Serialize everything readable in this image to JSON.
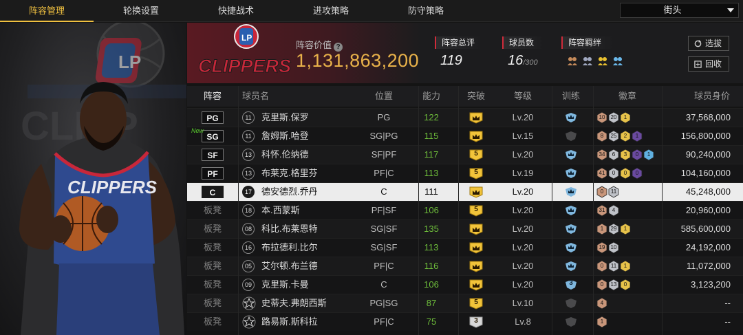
{
  "nav": {
    "tabs": [
      {
        "label": "阵容管理",
        "active": true
      },
      {
        "label": "轮换设置"
      },
      {
        "label": "快捷战术"
      },
      {
        "label": "进攻策略"
      },
      {
        "label": "防守策略"
      }
    ],
    "mode_select": {
      "value": "街头"
    }
  },
  "team": {
    "logo_text": "CLIPPERS",
    "art_jersey_text": "CLIPPERS",
    "value_label": "阵容价值",
    "value": "1,131,863,200",
    "overall_label": "阵容总评",
    "overall": "119",
    "players_label": "球员数",
    "players": "16",
    "players_max": "/300",
    "chemistry_label": "阵容羁绊"
  },
  "buttons": {
    "select": "选拔",
    "recycle": "回收"
  },
  "table": {
    "headers": [
      "阵容",
      "球员名",
      "位置",
      "能力",
      "突破",
      "等级",
      "训练",
      "徽章",
      "球员身价"
    ],
    "rows": [
      {
        "slot": "PG",
        "num": "11",
        "name": "克里斯.保罗",
        "pos": "PG",
        "ovr": "122",
        "brk": "crown",
        "level": "Lv.20",
        "train": "crown",
        "badges": [
          "10",
          "20",
          "1"
        ],
        "value": "37,568,000"
      },
      {
        "slot": "SG",
        "num": "11",
        "name": "詹姆斯.哈登",
        "pos": "SG|PG",
        "ovr": "115",
        "brk": "crown",
        "level": "Lv.15",
        "train": "none",
        "badges": [
          "8",
          "25",
          "2",
          "1"
        ],
        "value": "156,800,000",
        "new": "New"
      },
      {
        "slot": "SF",
        "num": "13",
        "name": "科怀.伦纳德",
        "pos": "SF|PF",
        "ovr": "117",
        "brk": "5",
        "level": "Lv.20",
        "train": "crown",
        "badges": [
          "34",
          "6",
          "3",
          "0",
          "1"
        ],
        "value": "90,240,000"
      },
      {
        "slot": "PF",
        "num": "13",
        "name": "布莱克.格里芬",
        "pos": "PF|C",
        "ovr": "113",
        "brk": "5",
        "level": "Lv.19",
        "train": "crown",
        "badges": [
          "41",
          "0",
          "0",
          "0"
        ],
        "value": "104,160,000"
      },
      {
        "slot": "C",
        "num": "17",
        "name": "德安德烈.乔丹",
        "pos": "C",
        "ovr": "111",
        "brk": "crown",
        "level": "Lv.20",
        "train": "crown",
        "badges": [
          "0",
          "11"
        ],
        "value": "45,248,000",
        "selected": true
      },
      {
        "slot": "板凳",
        "num": "18",
        "name": "本.西蒙斯",
        "pos": "PF|SF",
        "ovr": "106",
        "brk": "5",
        "level": "Lv.20",
        "train": "crown",
        "badges": [
          "31",
          "4"
        ],
        "value": "20,960,000"
      },
      {
        "slot": "板凳",
        "num": "08",
        "name": "科比.布莱恩特",
        "pos": "SG|SF",
        "ovr": "135",
        "brk": "crown",
        "level": "Lv.20",
        "train": "crown",
        "badges": [
          "1",
          "29",
          "1"
        ],
        "value": "585,600,000"
      },
      {
        "slot": "板凳",
        "num": "16",
        "name": "布拉德利.比尔",
        "pos": "SG|SF",
        "ovr": "113",
        "brk": "crown",
        "level": "Lv.20",
        "train": "crown",
        "badges": [
          "19",
          "10"
        ],
        "value": "24,192,000"
      },
      {
        "slot": "板凳",
        "num": "05",
        "name": "艾尔顿.布兰德",
        "pos": "PF|C",
        "ovr": "116",
        "brk": "crown",
        "level": "Lv.20",
        "train": "crown",
        "badges": [
          "0",
          "11",
          "1"
        ],
        "value": "11,072,000"
      },
      {
        "slot": "板凳",
        "num": "09",
        "name": "克里斯.卡曼",
        "pos": "C",
        "ovr": "106",
        "brk": "crown",
        "level": "Lv.20",
        "train": "3",
        "badges": [
          "0",
          "13",
          "0"
        ],
        "value": "3,123,200"
      },
      {
        "slot": "板凳",
        "num": "star",
        "name": "史蒂夫.弗朗西斯",
        "pos": "PG|SG",
        "ovr": "87",
        "brk": "5",
        "level": "Lv.10",
        "train": "none",
        "badges": [
          "4"
        ],
        "value": "--"
      },
      {
        "slot": "板凳",
        "num": "star",
        "name": "路易斯.斯科拉",
        "pos": "PF|C",
        "ovr": "75",
        "brk": "3",
        "level": "Lv.8",
        "train": "none",
        "badges": [
          "1"
        ],
        "value": "--"
      }
    ]
  },
  "colors": {
    "accent": "#f0c040",
    "ovr_green": "#6fbf3b",
    "team_red": "#d02b3a",
    "team_blue": "#2a5fb0"
  }
}
